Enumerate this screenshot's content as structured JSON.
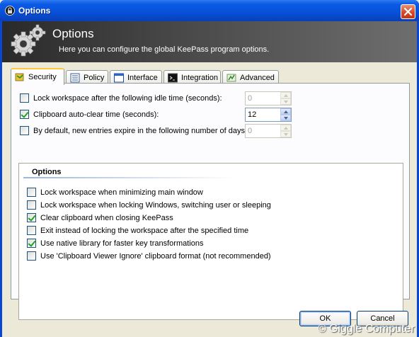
{
  "window": {
    "title": "Options"
  },
  "banner": {
    "title": "Options",
    "subtitle": "Here you can configure the global KeePass program options."
  },
  "tabs": [
    {
      "label": "Security",
      "icon": "security-icon",
      "active": true
    },
    {
      "label": "Policy",
      "icon": "policy-icon",
      "active": false
    },
    {
      "label": "Interface",
      "icon": "interface-icon",
      "active": false
    },
    {
      "label": "Integration",
      "icon": "integration-icon",
      "active": false
    },
    {
      "label": "Advanced",
      "icon": "advanced-icon",
      "active": false
    }
  ],
  "settings": {
    "lock_idle": {
      "label": "Lock workspace after the following idle time (seconds):",
      "checked": false,
      "value": "0",
      "enabled": false
    },
    "clipboard_clear": {
      "label": "Clipboard auto-clear time (seconds):",
      "checked": true,
      "value": "12",
      "enabled": true
    },
    "expire_default": {
      "label": "By default, new entries expire in the following number of days:",
      "checked": false,
      "value": "0",
      "enabled": false
    }
  },
  "options": {
    "header": "Options",
    "items": [
      {
        "label": "Lock workspace when minimizing main window",
        "checked": false
      },
      {
        "label": "Lock workspace when locking Windows, switching user or sleeping",
        "checked": false
      },
      {
        "label": "Clear clipboard when closing KeePass",
        "checked": true
      },
      {
        "label": "Exit instead of locking the workspace after the specified time",
        "checked": false
      },
      {
        "label": "Use native library for faster key transformations",
        "checked": true
      },
      {
        "label": "Use 'Clipboard Viewer Ignore' clipboard format (not recommended)",
        "checked": false
      }
    ]
  },
  "buttons": {
    "ok": "OK",
    "cancel": "Cancel"
  },
  "watermark": "© Giggle Computer"
}
